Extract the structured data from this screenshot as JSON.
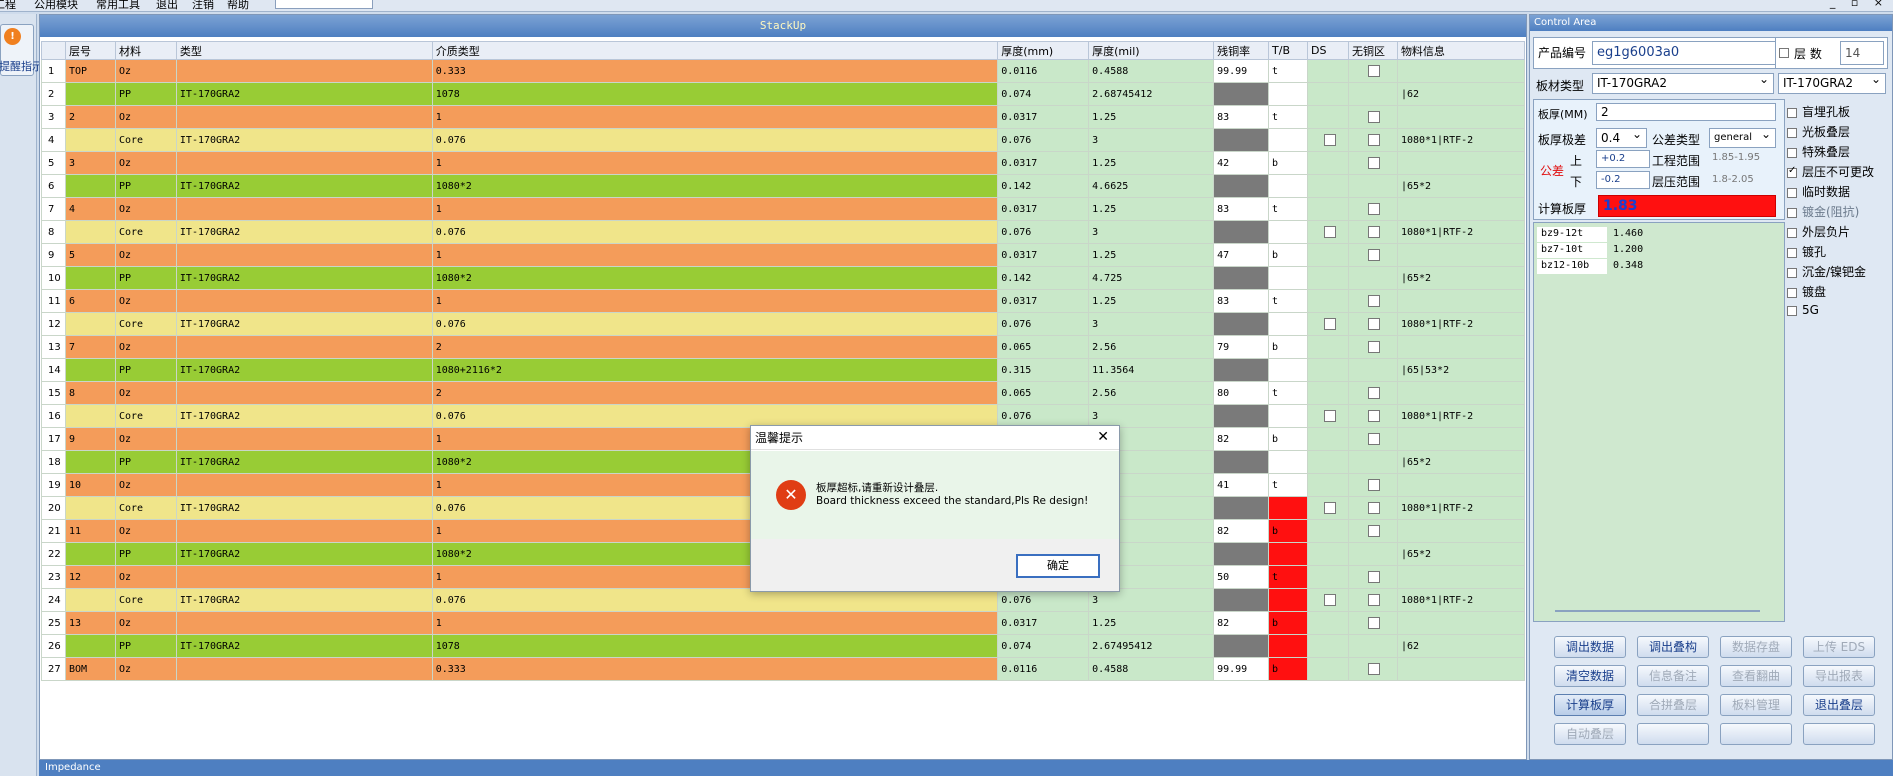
{
  "menu": {
    "items": [
      "工程",
      "公用模块",
      "常用工具",
      "退出",
      "注销",
      "帮助"
    ],
    "window_controls": "_ ▫ ×"
  },
  "left": {
    "hint_label": "提醒指示"
  },
  "stackup": {
    "title": "StackUp",
    "columns": [
      "",
      "层号",
      "材料",
      "类型",
      "介质类型",
      "厚度(mm)",
      "厚度(mil)",
      "残铜率",
      "T/B",
      "DS",
      "无铜区",
      "物料信息"
    ],
    "rows": [
      {
        "n": "1",
        "layer": "TOP",
        "mat": "Oz",
        "type": "",
        "dielectric": "0.333",
        "mm": "0.0116",
        "mil": "0.4588",
        "res": "99.99",
        "tb": "t",
        "kind": "cu",
        "resc": "wh",
        "tbc": "wh",
        "ds": false,
        "nocu": true,
        "info": ""
      },
      {
        "n": "2",
        "layer": "",
        "mat": "PP",
        "type": "IT-170GRA2",
        "dielectric": "1078",
        "mm": "0.074",
        "mil": "2.68745412",
        "res": "",
        "tb": "",
        "kind": "pp",
        "resc": "dk",
        "tbc": "wh",
        "ds": false,
        "nocu": false,
        "info": "|62"
      },
      {
        "n": "3",
        "layer": "2",
        "mat": "Oz",
        "type": "",
        "dielectric": "1",
        "mm": "0.0317",
        "mil": "1.25",
        "res": "83",
        "tb": "t",
        "kind": "cu",
        "resc": "wh",
        "tbc": "wh",
        "ds": false,
        "nocu": true,
        "info": ""
      },
      {
        "n": "4",
        "layer": "",
        "mat": "Core",
        "type": "IT-170GRA2",
        "dielectric": "0.076",
        "mm": "0.076",
        "mil": "3",
        "res": "",
        "tb": "",
        "kind": "core",
        "resc": "dk",
        "tbc": "wh",
        "ds": true,
        "nocu": true,
        "info": "1080*1|RTF-2"
      },
      {
        "n": "5",
        "layer": "3",
        "mat": "Oz",
        "type": "",
        "dielectric": "1",
        "mm": "0.0317",
        "mil": "1.25",
        "res": "42",
        "tb": "b",
        "kind": "cu",
        "resc": "wh",
        "tbc": "wh",
        "ds": false,
        "nocu": true,
        "info": ""
      },
      {
        "n": "6",
        "layer": "",
        "mat": "PP",
        "type": "IT-170GRA2",
        "dielectric": "1080*2",
        "mm": "0.142",
        "mil": "4.6625",
        "res": "",
        "tb": "",
        "kind": "pp",
        "resc": "dk",
        "tbc": "wh",
        "ds": false,
        "nocu": false,
        "info": "|65*2"
      },
      {
        "n": "7",
        "layer": "4",
        "mat": "Oz",
        "type": "",
        "dielectric": "1",
        "mm": "0.0317",
        "mil": "1.25",
        "res": "83",
        "tb": "t",
        "kind": "cu",
        "resc": "wh",
        "tbc": "wh",
        "ds": false,
        "nocu": true,
        "info": ""
      },
      {
        "n": "8",
        "layer": "",
        "mat": "Core",
        "type": "IT-170GRA2",
        "dielectric": "0.076",
        "mm": "0.076",
        "mil": "3",
        "res": "",
        "tb": "",
        "kind": "core",
        "resc": "dk",
        "tbc": "wh",
        "ds": true,
        "nocu": true,
        "info": "1080*1|RTF-2"
      },
      {
        "n": "9",
        "layer": "5",
        "mat": "Oz",
        "type": "",
        "dielectric": "1",
        "mm": "0.0317",
        "mil": "1.25",
        "res": "47",
        "tb": "b",
        "kind": "cu",
        "resc": "wh",
        "tbc": "wh",
        "ds": false,
        "nocu": true,
        "info": ""
      },
      {
        "n": "10",
        "layer": "",
        "mat": "PP",
        "type": "IT-170GRA2",
        "dielectric": "1080*2",
        "mm": "0.142",
        "mil": "4.725",
        "res": "",
        "tb": "",
        "kind": "pp",
        "resc": "dk",
        "tbc": "wh",
        "ds": false,
        "nocu": false,
        "info": "|65*2"
      },
      {
        "n": "11",
        "layer": "6",
        "mat": "Oz",
        "type": "",
        "dielectric": "1",
        "mm": "0.0317",
        "mil": "1.25",
        "res": "83",
        "tb": "t",
        "kind": "cu",
        "resc": "wh",
        "tbc": "wh",
        "ds": false,
        "nocu": true,
        "info": ""
      },
      {
        "n": "12",
        "layer": "",
        "mat": "Core",
        "type": "IT-170GRA2",
        "dielectric": "0.076",
        "mm": "0.076",
        "mil": "3",
        "res": "",
        "tb": "",
        "kind": "core",
        "resc": "dk",
        "tbc": "wh",
        "ds": true,
        "nocu": true,
        "info": "1080*1|RTF-2"
      },
      {
        "n": "13",
        "layer": "7",
        "mat": "Oz",
        "type": "",
        "dielectric": "2",
        "mm": "0.065",
        "mil": "2.56",
        "res": "79",
        "tb": "b",
        "kind": "cu",
        "resc": "wh",
        "tbc": "wh",
        "ds": false,
        "nocu": true,
        "info": ""
      },
      {
        "n": "14",
        "layer": "",
        "mat": "PP",
        "type": "IT-170GRA2",
        "dielectric": "1080+2116*2",
        "mm": "0.315",
        "mil": "11.3564",
        "res": "",
        "tb": "",
        "kind": "pp",
        "resc": "dk",
        "tbc": "wh",
        "ds": false,
        "nocu": false,
        "info": "|65|53*2"
      },
      {
        "n": "15",
        "layer": "8",
        "mat": "Oz",
        "type": "",
        "dielectric": "2",
        "mm": "0.065",
        "mil": "2.56",
        "res": "80",
        "tb": "t",
        "kind": "cu",
        "resc": "wh",
        "tbc": "wh",
        "ds": false,
        "nocu": true,
        "info": ""
      },
      {
        "n": "16",
        "layer": "",
        "mat": "Core",
        "type": "IT-170GRA2",
        "dielectric": "0.076",
        "mm": "0.076",
        "mil": "3",
        "res": "",
        "tb": "",
        "kind": "core",
        "resc": "dk",
        "tbc": "wh",
        "ds": true,
        "nocu": true,
        "info": "1080*1|RTF-2"
      },
      {
        "n": "17",
        "layer": "9",
        "mat": "Oz",
        "type": "",
        "dielectric": "1",
        "mm": "",
        "mil": "",
        "res": "82",
        "tb": "b",
        "kind": "cu",
        "resc": "wh",
        "tbc": "wh",
        "ds": false,
        "nocu": true,
        "info": ""
      },
      {
        "n": "18",
        "layer": "",
        "mat": "PP",
        "type": "IT-170GRA2",
        "dielectric": "1080*2",
        "mm": "",
        "mil": "75",
        "res": "",
        "tb": "",
        "kind": "pp",
        "resc": "dk",
        "tbc": "wh",
        "ds": false,
        "nocu": false,
        "info": "|65*2"
      },
      {
        "n": "19",
        "layer": "10",
        "mat": "Oz",
        "type": "",
        "dielectric": "1",
        "mm": "",
        "mil": "",
        "res": "41",
        "tb": "t",
        "kind": "cu",
        "resc": "wh",
        "tbc": "wh",
        "ds": false,
        "nocu": true,
        "info": ""
      },
      {
        "n": "20",
        "layer": "",
        "mat": "Core",
        "type": "IT-170GRA2",
        "dielectric": "0.076",
        "mm": "",
        "mil": "",
        "res": "",
        "tb": "",
        "kind": "core",
        "resc": "dk",
        "tbc": "rd",
        "ds": true,
        "nocu": true,
        "info": "1080*1|RTF-2"
      },
      {
        "n": "21",
        "layer": "11",
        "mat": "Oz",
        "type": "",
        "dielectric": "1",
        "mm": "",
        "mil": "",
        "res": "82",
        "tb": "b",
        "kind": "cu",
        "resc": "wh",
        "tbc": "rd",
        "ds": false,
        "nocu": true,
        "info": ""
      },
      {
        "n": "22",
        "layer": "",
        "mat": "PP",
        "type": "IT-170GRA2",
        "dielectric": "1080*2",
        "mm": "",
        "mil": "",
        "res": "",
        "tb": "",
        "kind": "pp",
        "resc": "dk",
        "tbc": "rd",
        "ds": false,
        "nocu": false,
        "info": "|65*2"
      },
      {
        "n": "23",
        "layer": "12",
        "mat": "Oz",
        "type": "",
        "dielectric": "1",
        "mm": "",
        "mil": "",
        "res": "50",
        "tb": "t",
        "kind": "cu",
        "resc": "wh",
        "tbc": "rd",
        "ds": false,
        "nocu": true,
        "info": ""
      },
      {
        "n": "24",
        "layer": "",
        "mat": "Core",
        "type": "IT-170GRA2",
        "dielectric": "0.076",
        "mm": "0.076",
        "mil": "3",
        "res": "",
        "tb": "",
        "kind": "core",
        "resc": "dk",
        "tbc": "rd",
        "ds": true,
        "nocu": true,
        "info": "1080*1|RTF-2"
      },
      {
        "n": "25",
        "layer": "13",
        "mat": "Oz",
        "type": "",
        "dielectric": "1",
        "mm": "0.0317",
        "mil": "1.25",
        "res": "82",
        "tb": "b",
        "kind": "cu",
        "resc": "wh",
        "tbc": "rd",
        "ds": false,
        "nocu": true,
        "info": ""
      },
      {
        "n": "26",
        "layer": "",
        "mat": "PP",
        "type": "IT-170GRA2",
        "dielectric": "1078",
        "mm": "0.074",
        "mil": "2.67495412",
        "res": "",
        "tb": "",
        "kind": "pp",
        "resc": "dk",
        "tbc": "rd",
        "ds": false,
        "nocu": false,
        "info": "|62"
      },
      {
        "n": "27",
        "layer": "BOM",
        "mat": "Oz",
        "type": "",
        "dielectric": "0.333",
        "mm": "0.0116",
        "mil": "0.4588",
        "res": "99.99",
        "tb": "b",
        "kind": "cu",
        "resc": "wh",
        "tbc": "rd",
        "ds": false,
        "nocu": true,
        "info": ""
      }
    ]
  },
  "impedance": {
    "title": "Impedance"
  },
  "control": {
    "title": "Control Area",
    "product_label": "产品编号",
    "product_value": "eg1g6003a0",
    "layers_label": "层 数",
    "layers_value": "14",
    "board_type_label": "板材类型",
    "board_type_value": "IT-170GRA2",
    "board_type_value2": "IT-170GRA2",
    "thickness_label": "板厚(MM)",
    "thickness_value": "2",
    "limit_label": "板厚极差",
    "limit_value": "0.4",
    "tol_type_label": "公差类型",
    "tol_type_value": "general",
    "tol_label": "公差",
    "upper_label": "上",
    "lower_label": "下",
    "upper_value": "+0.2",
    "lower_value": "-0.2",
    "eng_range_label": "工程范围",
    "eng_range_value": "1.85-1.95",
    "press_range_label": "层压范围",
    "press_range_value": "1.8-2.05",
    "calc_label": "计算板厚",
    "calc_value": "1.83",
    "results": [
      {
        "name": "bz9-12t",
        "value": "1.460"
      },
      {
        "name": "bz7-10t",
        "value": "1.200"
      },
      {
        "name": "bz12-10b",
        "value": "0.348"
      }
    ],
    "options": [
      {
        "label": "盲埋孔板",
        "checked": false,
        "dim": false
      },
      {
        "label": "光板叠层",
        "checked": false,
        "dim": false
      },
      {
        "label": "特殊叠层",
        "checked": false,
        "dim": false
      },
      {
        "label": "层压不可更改",
        "checked": true,
        "dim": false
      },
      {
        "label": "临时数据",
        "checked": false,
        "dim": false
      },
      {
        "label": "镀金(阻抗)",
        "checked": false,
        "dim": true
      },
      {
        "label": "外层负片",
        "checked": false,
        "dim": false
      },
      {
        "label": "镀孔",
        "checked": false,
        "dim": false
      },
      {
        "label": "沉金/镍钯金",
        "checked": false,
        "dim": false
      },
      {
        "label": "镀盘",
        "checked": false,
        "dim": false
      },
      {
        "label": "5G",
        "checked": false,
        "dim": false
      }
    ],
    "buttons": [
      {
        "label": "调出数据",
        "state": "normal"
      },
      {
        "label": "调出叠构",
        "state": "normal"
      },
      {
        "label": "数据存盘",
        "state": "dis"
      },
      {
        "label": "上传 EDS",
        "state": "dis"
      },
      {
        "label": "清空数据",
        "state": "normal"
      },
      {
        "label": "信息备注",
        "state": "dis"
      },
      {
        "label": "查看翻曲",
        "state": "dis"
      },
      {
        "label": "导出报表",
        "state": "dis"
      },
      {
        "label": "计算板厚",
        "state": "act"
      },
      {
        "label": "合拼叠层",
        "state": "dis"
      },
      {
        "label": "板料管理",
        "state": "dis"
      },
      {
        "label": "退出叠层",
        "state": "normal"
      },
      {
        "label": "自动叠层",
        "state": "dis"
      },
      {
        "label": "",
        "state": "dis"
      },
      {
        "label": "",
        "state": "dis"
      },
      {
        "label": "",
        "state": "dis"
      }
    ]
  },
  "dialog": {
    "title": "温馨提示",
    "line1": "板厚超标,请重新设计叠层.",
    "line2": "Board thickness exceed the standard,Pls Re design!",
    "ok": "确定"
  },
  "colors": {
    "copper": "#f49c5a",
    "pp": "#98cc35",
    "core": "#f0e58a",
    "alert": "#ff1010",
    "accent": "#4e7fc1"
  }
}
